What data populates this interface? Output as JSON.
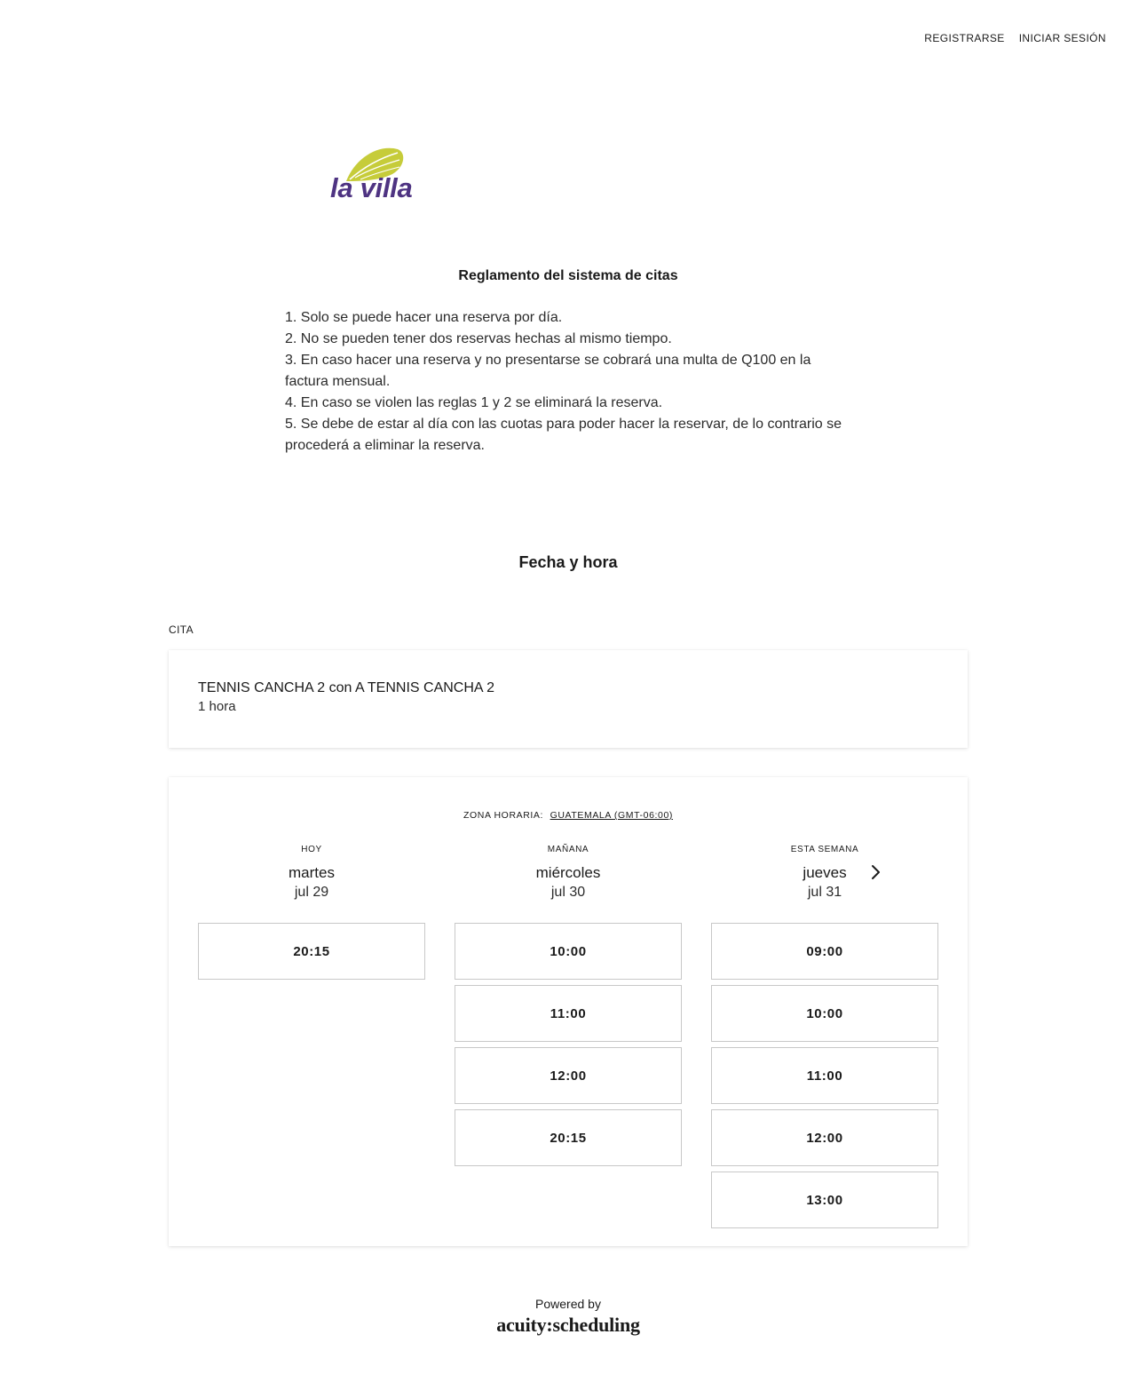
{
  "nav": {
    "register": "REGISTRARSE",
    "login": "INICIAR SESIÓN"
  },
  "logo": {
    "text": "la villa",
    "leaf_color": "#c6cc3a",
    "text_color": "#4e3382"
  },
  "rules": {
    "title": "Reglamento del sistema de citas",
    "items": [
      "1. Solo se puede hacer una reserva por día.",
      "2. No se pueden tener dos reservas hechas al mismo tiempo.",
      "3. En caso hacer una reserva y no presentarse se cobrará una multa de Q100 en la factura mensual.",
      "4. En caso se violen las reglas 1 y 2 se eliminará la reserva.",
      "5. Se debe de estar al día con las cuotas para poder hacer la reservar, de lo contrario se procederá a eliminar la reserva."
    ]
  },
  "section_title": "Fecha y hora",
  "appointment": {
    "label": "CITA",
    "name": "TENNIS CANCHA 2 con A TENNIS CANCHA 2",
    "duration": "1 hora"
  },
  "calendar": {
    "timezone_label": "ZONA HORARIA:",
    "timezone_value": "GUATEMALA (GMT-06:00)",
    "next_icon": "chevron-right-icon",
    "columns": [
      {
        "caption": "HOY",
        "day": "martes",
        "date": "jul 29",
        "slots": [
          "20:15"
        ]
      },
      {
        "caption": "MAÑANA",
        "day": "miércoles",
        "date": "jul 30",
        "slots": [
          "10:00",
          "11:00",
          "12:00",
          "20:15"
        ]
      },
      {
        "caption": "ESTA SEMANA",
        "day": "jueves",
        "date": "jul 31",
        "slots": [
          "09:00",
          "10:00",
          "11:00",
          "12:00",
          "13:00"
        ]
      }
    ]
  },
  "footer": {
    "powered_by": "Powered by",
    "brand": "acuity:scheduling"
  }
}
